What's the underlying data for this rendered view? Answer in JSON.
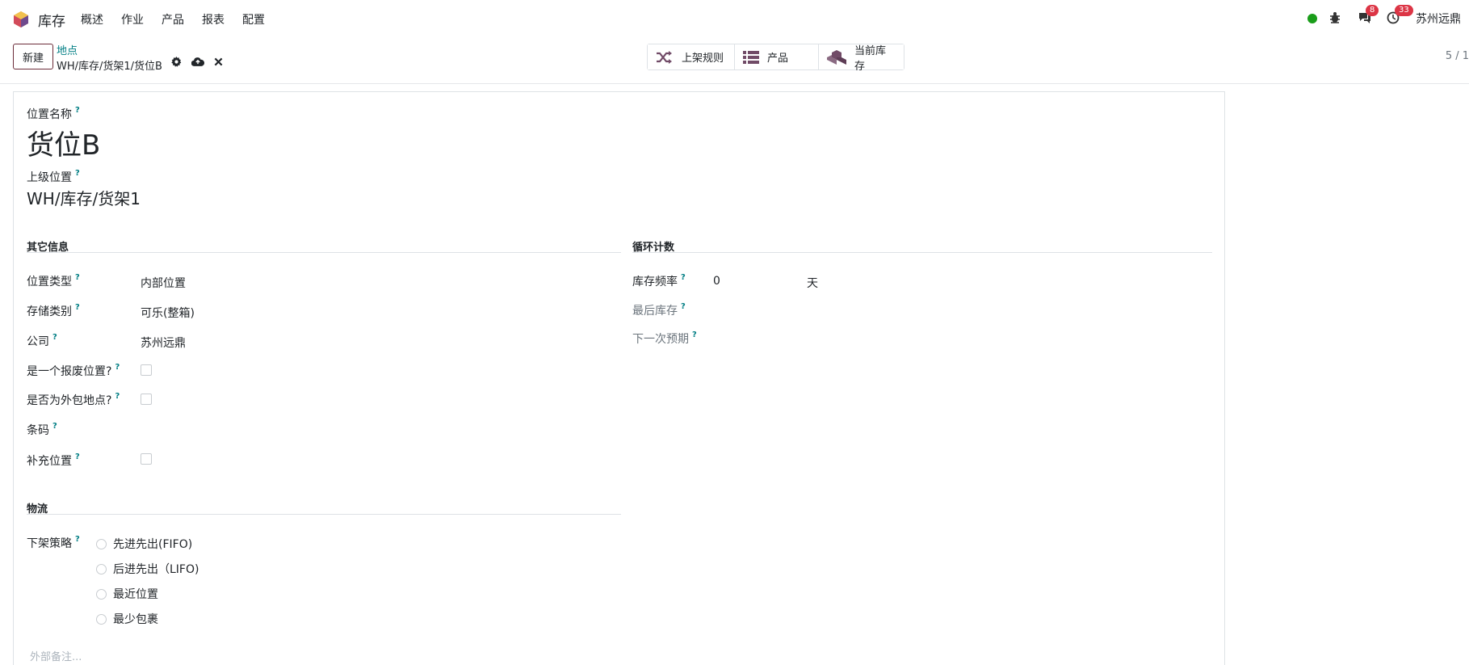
{
  "navbar": {
    "app_name": "库存",
    "menu": [
      "概述",
      "作业",
      "产品",
      "报表",
      "配置"
    ],
    "chat_count": "8",
    "activity_count": "33",
    "user_name": "苏州远鼎"
  },
  "control": {
    "new_label": "新建",
    "breadcrumb_parent": "地点",
    "breadcrumb_current": "WH/库存/货架1/货位B",
    "pager": "5 / 1"
  },
  "smart_buttons": {
    "putaway": "上架规则",
    "products": "产品",
    "current_stock": "当前库存"
  },
  "form": {
    "name_label": "位置名称",
    "name_value": "货位B",
    "parent_label": "上级位置",
    "parent_value": "WH/库存/货架1",
    "other_info": {
      "title": "其它信息",
      "location_type_label": "位置类型",
      "location_type_value": "内部位置",
      "storage_category_label": "存储类别",
      "storage_category_value": "可乐(整箱)",
      "company_label": "公司",
      "company_value": "苏州远鼎",
      "scrap_label": "是一个报废位置?",
      "subcontract_label": "是否为外包地点?",
      "barcode_label": "条码",
      "replenish_label": "补充位置"
    },
    "cyclic": {
      "title": "循环计数",
      "frequency_label": "库存频率",
      "frequency_value": "0",
      "frequency_unit": "天",
      "last_inventory_label": "最后库存",
      "next_expected_label": "下一次预期"
    },
    "logistics": {
      "title": "物流",
      "removal_label": "下架策略",
      "options": [
        "先进先出(FIFO)",
        "后进先出（LIFO)",
        "最近位置",
        "最少包裹"
      ]
    },
    "note_placeholder": "外部备注..."
  },
  "colors": {
    "brand": "#714B67",
    "link": "#017e84",
    "badge": "#dc3545",
    "presence": "#1a9d1a"
  }
}
